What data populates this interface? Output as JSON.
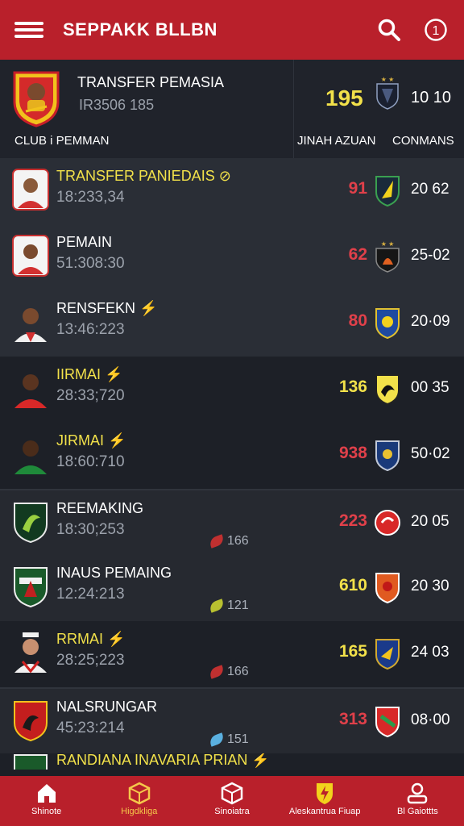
{
  "header": {
    "title": "SEPPAKK BLLBN",
    "menu_icon": "hamburger-menu-icon",
    "search_icon": "search-icon",
    "info_icon": "info-icon"
  },
  "featured": {
    "name": "TRANSFER PEMASIA",
    "sub": "IR3506 185",
    "score": "195",
    "value": "10 10",
    "col_left": "CLUB i PEMMAN",
    "col_mid": "JINAH AZUAN",
    "col_right": "CONMANS"
  },
  "colors": {
    "brand_red": "#b9202b",
    "score_yellow": "#f2e14a",
    "score_red": "#e0404a"
  },
  "players": [
    {
      "name": "TRANSFER PANIEDAIS ⊘",
      "time": "18:233,34",
      "score": "91",
      "score_color": "#e0404a",
      "value": "20 62",
      "name_yellow": true,
      "tag": ""
    },
    {
      "name": "PEMAIN",
      "time": "51:308:30",
      "score": "62",
      "score_color": "#e0404a",
      "value": "25-02",
      "name_yellow": false,
      "tag": ""
    },
    {
      "name": "RENSFEKN ⚡",
      "time": "13:46:223",
      "score": "80",
      "score_color": "#e0404a",
      "value": "20·09",
      "name_yellow": false,
      "tag": ""
    },
    {
      "name": "IIRMAI ⚡",
      "time": "28:33;720",
      "score": "136",
      "score_color": "#f2e14a",
      "value": "00 35",
      "name_yellow": true,
      "tag": ""
    },
    {
      "name": "JIRMAI ⚡",
      "time": "18:60:710",
      "score": "938",
      "score_color": "#e0404a",
      "value": "50·02",
      "name_yellow": true,
      "tag": ""
    },
    {
      "name": "REEMAKING",
      "time": "18:30;253",
      "score": "223",
      "score_color": "#e0404a",
      "value": "20 05",
      "name_yellow": false,
      "tag": "166"
    },
    {
      "name": "INAUS PEMAING",
      "time": "12:24:213",
      "score": "610",
      "score_color": "#f2e14a",
      "value": "20 30",
      "name_yellow": false,
      "tag": "121"
    },
    {
      "name": "RRMAI ⚡",
      "time": "28:25;223",
      "score": "165",
      "score_color": "#f2e14a",
      "value": "24 03",
      "name_yellow": true,
      "tag": "166"
    },
    {
      "name": "NALSRUNGAR",
      "time": "45:23:214",
      "score": "313",
      "score_color": "#e0404a",
      "value": "08·00",
      "name_yellow": false,
      "tag": "151"
    },
    {
      "name": "RANDIANA INAVARIA PRIAN ⚡",
      "time": "",
      "score": "",
      "score_color": "#e0404a",
      "value": "",
      "name_yellow": true,
      "tag": ""
    }
  ],
  "nav": [
    {
      "label": "Shinote",
      "icon": "home-icon"
    },
    {
      "label": "Higdkliga",
      "icon": "cube-icon"
    },
    {
      "label": "Sinoiatra",
      "icon": "box-icon"
    },
    {
      "label": "Aleskantrua Fiuap",
      "icon": "shield-bolt-icon"
    },
    {
      "label": "Bl Gaiottts",
      "icon": "profile-icon"
    }
  ]
}
